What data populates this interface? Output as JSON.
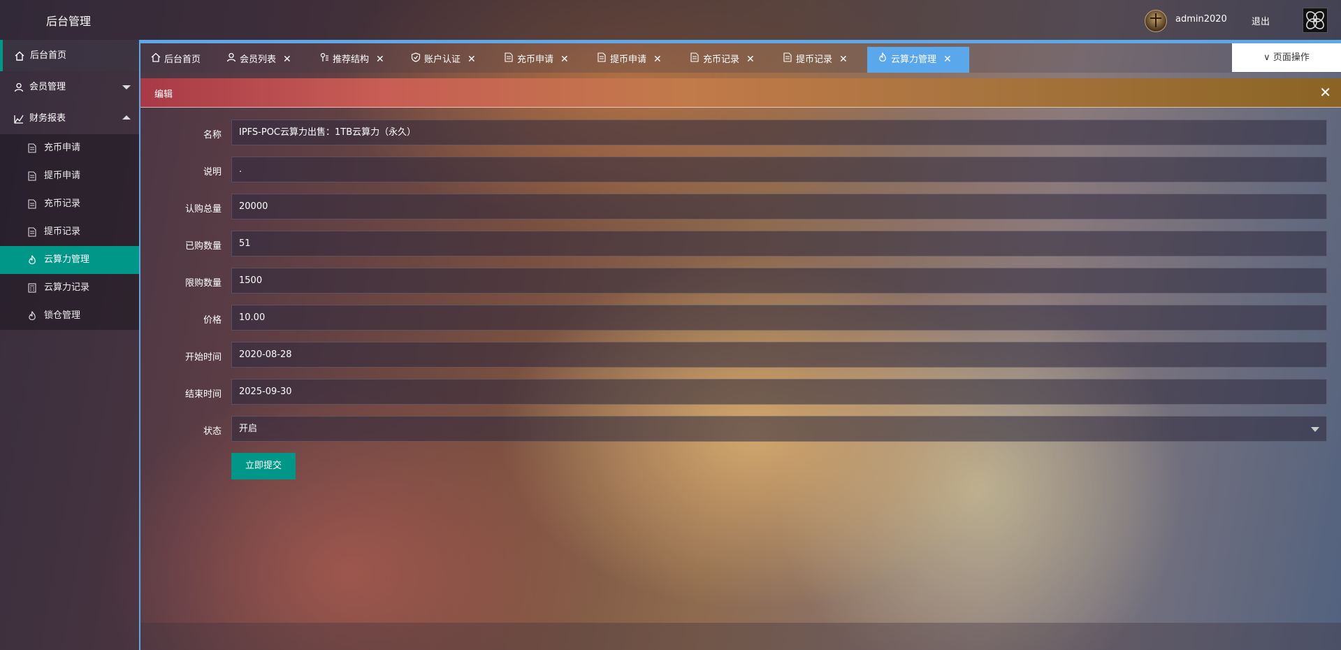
{
  "header": {
    "title": "后台管理",
    "username": "admin2020",
    "logout_label": "退出"
  },
  "sidebar": {
    "items": [
      {
        "label": "后台首页",
        "icon": "home-icon"
      },
      {
        "label": "会员管理",
        "icon": "user-icon"
      },
      {
        "label": "财务报表",
        "icon": "chart-icon"
      }
    ],
    "sub_items": [
      {
        "label": "充币申请",
        "icon": "document-icon"
      },
      {
        "label": "提币申请",
        "icon": "document-icon"
      },
      {
        "label": "充币记录",
        "icon": "document-icon"
      },
      {
        "label": "提币记录",
        "icon": "document-icon"
      },
      {
        "label": "云算力管理",
        "icon": "fire-icon"
      },
      {
        "label": "云算力记录",
        "icon": "calculator-icon"
      },
      {
        "label": "锁仓管理",
        "icon": "fire-icon"
      }
    ]
  },
  "tabs": [
    {
      "label": "后台首页",
      "icon": "home-icon"
    },
    {
      "label": "会员列表",
      "icon": "user-icon"
    },
    {
      "label": "推荐结构",
      "icon": "share-icon"
    },
    {
      "label": "账户认证",
      "icon": "shield-icon"
    },
    {
      "label": "充币申请",
      "icon": "document-icon"
    },
    {
      "label": "提币申请",
      "icon": "document-icon"
    },
    {
      "label": "充币记录",
      "icon": "document-icon"
    },
    {
      "label": "提币记录",
      "icon": "document-icon"
    },
    {
      "label": "云算力管理",
      "icon": "fire-icon"
    }
  ],
  "page_ops_label": "页面操作",
  "panel": {
    "title": "编辑",
    "close_glyph": "✕"
  },
  "form": {
    "fields": [
      {
        "label": "名称",
        "value": "IPFS-POC云算力出售：1TB云算力（永久）"
      },
      {
        "label": "说明",
        "value": "."
      },
      {
        "label": "认购总量",
        "value": "20000"
      },
      {
        "label": "已购数量",
        "value": "51"
      },
      {
        "label": "限购数量",
        "value": "1500"
      },
      {
        "label": "价格",
        "value": "10.00"
      },
      {
        "label": "开始时间",
        "value": "2020-08-28"
      },
      {
        "label": "结束时间",
        "value": "2025-09-30"
      },
      {
        "label": "状态",
        "value": "开启"
      }
    ],
    "submit_label": "立即提交"
  },
  "colors": {
    "accent": "#009688",
    "tab_active": "#5aa7ec"
  }
}
